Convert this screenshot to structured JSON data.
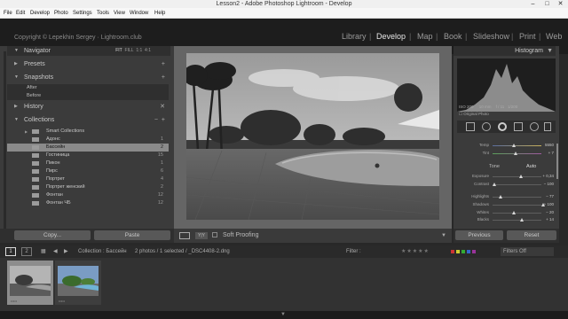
{
  "window": {
    "title": "Lesson2 - Adobe Photoshop Lightroom - Develop"
  },
  "menu": [
    "File",
    "Edit",
    "Develop",
    "Photo",
    "Settings",
    "Tools",
    "View",
    "Window",
    "Help"
  ],
  "identity_plate": "Copyright © Lepekhin Sergey · Lightroom.club",
  "modules": [
    "Library",
    "Develop",
    "Map",
    "Book",
    "Slideshow",
    "Print",
    "Web"
  ],
  "active_module": "Develop",
  "left": {
    "navigator": {
      "title": "Navigator",
      "zoom": [
        "FIT",
        "FILL",
        "1:1",
        "4:1"
      ]
    },
    "presets": {
      "title": "Presets"
    },
    "snapshots": {
      "title": "Snapshots",
      "items": [
        "After",
        "Before"
      ]
    },
    "history": {
      "title": "History"
    },
    "collections": {
      "title": "Collections",
      "items": [
        {
          "name": "Smart Collections",
          "count": ""
        },
        {
          "name": "Адонс",
          "count": "1"
        },
        {
          "name": "Бассейн",
          "count": "2"
        },
        {
          "name": "Гостиница",
          "count": "15"
        },
        {
          "name": "Пикон",
          "count": "1"
        },
        {
          "name": "Пирс",
          "count": "6"
        },
        {
          "name": "Портрет",
          "count": "4"
        },
        {
          "name": "Портрет женский",
          "count": "2"
        },
        {
          "name": "Фонтан",
          "count": "12"
        },
        {
          "name": "Фонтан ЧБ",
          "count": "12"
        }
      ]
    },
    "copy_button": "Copy...",
    "paste_button": "Paste"
  },
  "toolbar": {
    "soft_proofing": "Soft Proofing"
  },
  "right": {
    "histogram": {
      "title": "Histogram",
      "iso": "ISO 200",
      "focal": "10 mm",
      "aperture": "f / 11",
      "shutter": "1/200",
      "original_photo": "Original Photo"
    },
    "temp_label": "Temp",
    "temp_value": "5550",
    "tint_label": "Tint",
    "tint_value": "+ 7",
    "tone_label": "Tone",
    "auto_label": "Auto",
    "sliders": [
      {
        "label": "Exposure",
        "value": "+ 0,34",
        "pos": 0.55
      },
      {
        "label": "Contrast",
        "value": "− 100",
        "pos": 0.0
      },
      {
        "label": "Highlights",
        "value": "− 77",
        "pos": 0.12
      },
      {
        "label": "Shadows",
        "value": "+ 100",
        "pos": 1.0
      },
      {
        "label": "Whites",
        "value": "− 20",
        "pos": 0.4
      },
      {
        "label": "Blacks",
        "value": "+ 14",
        "pos": 0.57
      }
    ],
    "previous_button": "Previous",
    "reset_button": "Reset"
  },
  "filmstrip": {
    "page1": "1",
    "page2": "2",
    "source": "Collection : Бассейн",
    "info": "2 photos / 1 selected / _DSC4408-2.dng",
    "filter_label": "Filter :",
    "filter_state": "Filters Off"
  }
}
